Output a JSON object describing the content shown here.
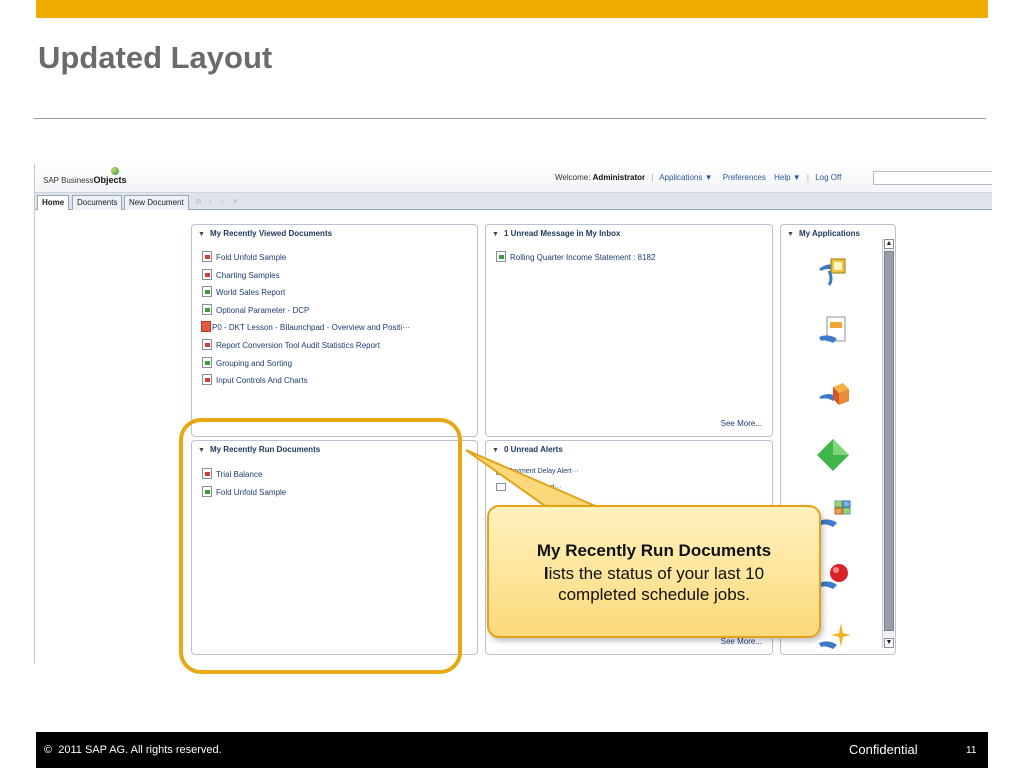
{
  "slide": {
    "title": "Updated Layout",
    "copyright": "2011 SAP AG. All rights reserved.",
    "copyright_symbol": "©",
    "confidential": "Confidential",
    "page_number": "11",
    "accent_color": "#f0ab00"
  },
  "app": {
    "brand_prefix": "SAP Business",
    "brand_suffix": "Objects",
    "welcome_label": "Welcome:",
    "user": "Administrator",
    "menu": {
      "applications": "Applications",
      "preferences": "Preferences",
      "help": "Help",
      "log_off": "Log Off"
    },
    "tabs": [
      {
        "label": "Home",
        "active": true
      },
      {
        "label": "Documents",
        "active": false
      },
      {
        "label": "New Document",
        "active": false
      }
    ],
    "panels": {
      "recently_viewed": {
        "title": "My Recently Viewed Documents",
        "items": [
          {
            "label": "Fold Unfold Sample",
            "icon": "red-report-icon"
          },
          {
            "label": "Charting Samples",
            "icon": "red-report-icon"
          },
          {
            "label": "World Sales Report",
            "icon": "green-report-icon"
          },
          {
            "label": "Optional Parameter - DCP",
            "icon": "green-report-icon"
          },
          {
            "label": "P0 - DKT Lesson - BIlaunchpad - Overview and Positi···",
            "icon": "powerpoint-icon"
          },
          {
            "label": "Report Conversion Tool Audit Statistics Report",
            "icon": "red-report-icon"
          },
          {
            "label": "Grouping and Sorting",
            "icon": "green-report-icon"
          },
          {
            "label": "Input Controls And Charts",
            "icon": "red-report-icon"
          }
        ]
      },
      "inbox": {
        "title": "1 Unread Message in My Inbox",
        "items": [
          {
            "label": "Rolling Quarter Income Statement : 8182",
            "icon": "green-report-icon"
          }
        ],
        "see_more": "See More..."
      },
      "recently_run": {
        "title": "My Recently Run Documents",
        "items": [
          {
            "label": "Trial Balance",
            "icon": "failed-instance-icon"
          },
          {
            "label": "Fold Unfold Sample",
            "icon": "success-instance-icon"
          }
        ]
      },
      "alerts": {
        "title": "0 Unread Alerts",
        "items": [
          {
            "label": "Payment Delay Alert···",
            "icon": "alert-icon"
          },
          {
            "label": "Alert···",
            "icon": "mail-icon"
          }
        ],
        "see_more": "See More..."
      },
      "applications": {
        "title": "My Applications",
        "icons": [
          "cmc-icon",
          "report-writer-icon",
          "cube-icon",
          "diamond-icon",
          "dashboard-icon",
          "red-sphere-icon",
          "star-icon"
        ]
      }
    }
  },
  "callout": {
    "title": "My Recently Run Documents",
    "body_first_letter": "l",
    "body": "ists the status of your last 10 completed schedule jobs."
  }
}
